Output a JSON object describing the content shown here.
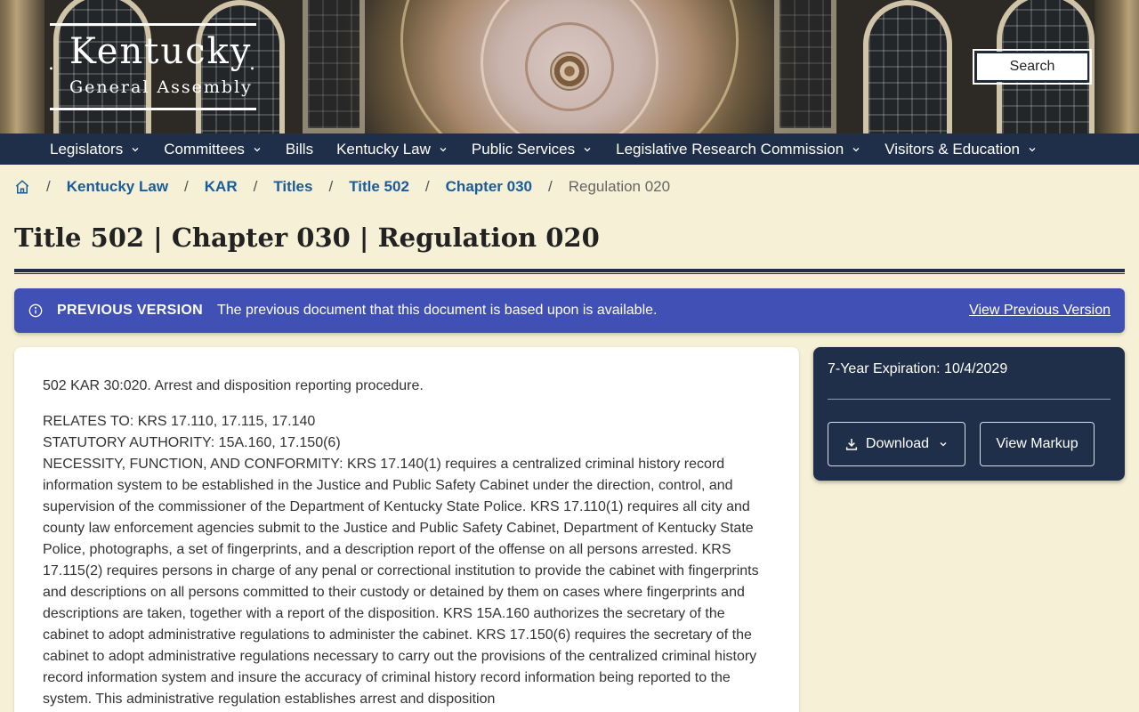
{
  "header": {
    "logo_main": "Kentucky",
    "logo_sub": "General Assembly",
    "search_label": "Search"
  },
  "nav": {
    "items": [
      {
        "label": "Legislators",
        "dropdown": true
      },
      {
        "label": "Committees",
        "dropdown": true
      },
      {
        "label": "Bills",
        "dropdown": false
      },
      {
        "label": "Kentucky Law",
        "dropdown": true
      },
      {
        "label": "Public Services",
        "dropdown": true
      },
      {
        "label": "Legislative Research Commission",
        "dropdown": true
      },
      {
        "label": "Visitors & Education",
        "dropdown": true
      }
    ]
  },
  "breadcrumb": {
    "home_icon": "home-icon",
    "links": [
      "Kentucky Law",
      "KAR",
      "Titles",
      "Title 502",
      "Chapter 030"
    ],
    "current": "Regulation 020"
  },
  "page": {
    "title": "Title 502 | Chapter 030 | Regulation 020"
  },
  "notice": {
    "icon": "info-icon",
    "label": "PREVIOUS VERSION",
    "text": "The previous document that this document is based upon is available.",
    "link": "View Previous Version"
  },
  "document": {
    "heading": "502 KAR 30:020.  Arrest and disposition reporting procedure.",
    "relates_to": "RELATES TO:  KRS 17.110, 17.115, 17.140",
    "statutory_authority": "STATUTORY AUTHORITY:  15A.160, 17.150(6)",
    "necessity": "NECESSITY, FUNCTION, AND CONFORMITY:  KRS 17.140(1) requires a centralized criminal history record information system to be established in the Justice and Public Safety Cabinet under the direction, control, and supervision of the commissioner of the Department of Kentucky State Police. KRS 17.110(1) requires all city and county law enforcement agencies submit to the Justice and Public Safety Cabinet, Department of Kentucky State Police, photographs, a set of fingerprints, and a description report of the offense on all persons arrested. KRS 17.115(2) requires persons in charge of any penal or correctional institution to provide the cabinet with fingerprints and descriptions on all persons committed to their custody or detained by them on cases where fingerprints and descriptions are taken, together with a report of the disposition. KRS 15A.160 authorizes the secretary of the cabinet to adopt administrative regulations to administer the cabinet. KRS 17.150(6) requires the secretary of the cabinet to adopt administrative regulations necessary to carry out the provisions of the centralized criminal history record information system and insure the accuracy of criminal history record information being reported to the system. This administrative regulation establishes arrest and disposition"
  },
  "side": {
    "expiration": "7-Year Expiration: 10/4/2029",
    "download_label": "Download",
    "markup_label": "View Markup"
  }
}
